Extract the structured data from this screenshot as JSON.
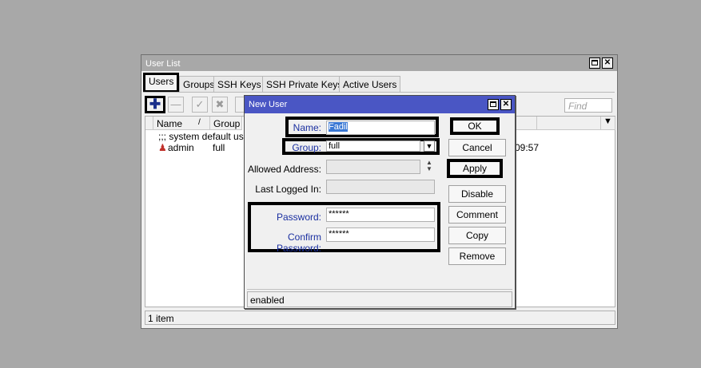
{
  "user_list": {
    "title": "User List",
    "tabs": [
      "Users",
      "Groups",
      "SSH Keys",
      "SSH Private Keys",
      "Active Users"
    ],
    "find_placeholder": "Find",
    "columns": {
      "name": "Name",
      "sort_mark": "/",
      "group": "Group"
    },
    "rows": [
      {
        "comment": ";;; system default user"
      },
      {
        "name": "admin",
        "group": "full",
        "last_logged": "09:57"
      }
    ],
    "status": "1 item"
  },
  "new_user": {
    "title": "New User",
    "fields": {
      "name_label": "Name:",
      "name_value": "Fadil",
      "group_label": "Group:",
      "group_value": "full",
      "allowed_label": "Allowed Address:",
      "allowed_value": "",
      "last_label": "Last Logged In:",
      "last_value": "",
      "password_label": "Password:",
      "password_value": "******",
      "confirm_label": "Confirm Password:",
      "confirm_value": "******"
    },
    "buttons": {
      "ok": "OK",
      "cancel": "Cancel",
      "apply": "Apply",
      "disable": "Disable",
      "comment": "Comment",
      "copy": "Copy",
      "remove": "Remove"
    },
    "status": "enabled"
  },
  "colors": {
    "dialog_title": "#4a56c4",
    "label_blue": "#1a2fa0",
    "add_icon": "#1a2f8a",
    "admin_icon": "#c0302a"
  },
  "icons": [
    "add-icon",
    "remove-icon",
    "enable-icon",
    "disable-icon",
    "admin-user-icon",
    "dropdown-arrow-icon",
    "spinner-icon"
  ]
}
